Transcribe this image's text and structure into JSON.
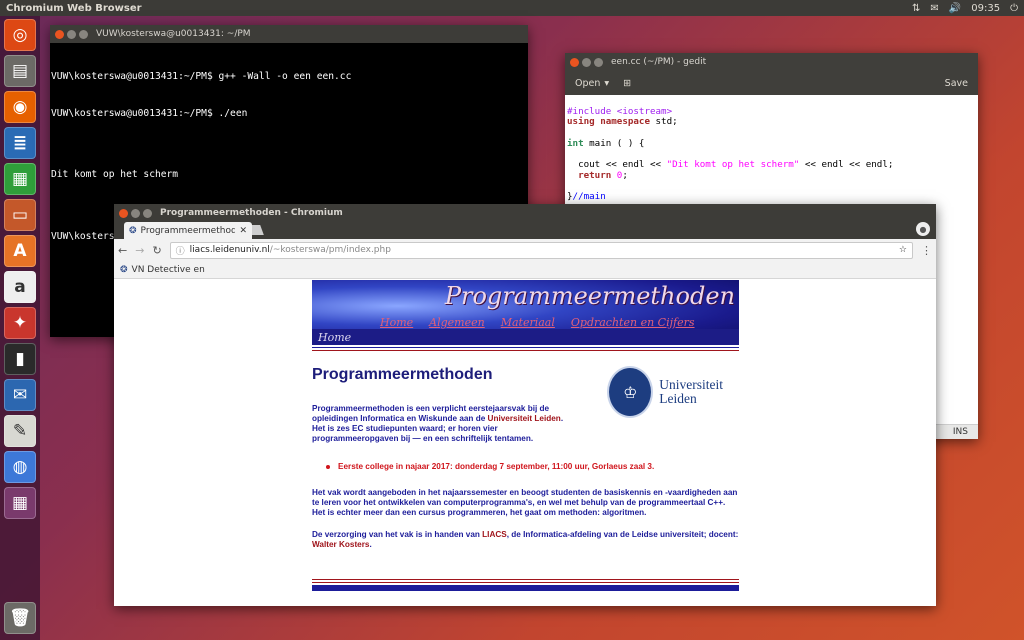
{
  "topbar": {
    "title": "Chromium Web Browser",
    "time": "09:35"
  },
  "launcher": [
    {
      "name": "ubuntu-dash-icon",
      "color": "#dd4814",
      "glyph": "◎"
    },
    {
      "name": "files-icon",
      "color": "#6c6a66",
      "glyph": "▤"
    },
    {
      "name": "firefox-icon",
      "color": "#e66000",
      "glyph": "◉"
    },
    {
      "name": "writer-icon",
      "color": "#2a6bb5",
      "glyph": "≣"
    },
    {
      "name": "calc-icon",
      "color": "#2f9e3a",
      "glyph": "▦"
    },
    {
      "name": "impress-icon",
      "color": "#c4582a",
      "glyph": "▭"
    },
    {
      "name": "software-center-icon",
      "color": "#e67326",
      "glyph": "A"
    },
    {
      "name": "amazon-icon",
      "color": "#efefef",
      "glyph": "a"
    },
    {
      "name": "system-settings-icon",
      "color": "#c9362d",
      "glyph": "✦"
    },
    {
      "name": "terminal-icon",
      "color": "#2a2a2a",
      "glyph": "▮"
    },
    {
      "name": "thunderbird-icon",
      "color": "#2c67b0",
      "glyph": "✉"
    },
    {
      "name": "text-editor-icon",
      "color": "#d8d8d2",
      "glyph": "✎"
    },
    {
      "name": "chromium-icon",
      "color": "#3d78d8",
      "glyph": "◍"
    },
    {
      "name": "workspaces-icon",
      "color": "#7a3a6c",
      "glyph": "▦"
    }
  ],
  "terminal": {
    "title": "VUW\\kosterswa@u0013431: ~/PM",
    "lines": [
      "VUW\\kosterswa@u0013431:~/PM$ g++ -Wall -o een een.cc",
      "VUW\\kosterswa@u0013431:~/PM$ ./een",
      "",
      "Dit komt op het scherm",
      "",
      "VUW\\kosterswa@u0013431:~/PM$ "
    ]
  },
  "gedit": {
    "title": "een.cc (~/PM) - gedit",
    "open_label": "Open",
    "save_label": "Save",
    "status": "INS",
    "code": {
      "include": "#include <iostream>",
      "using_kw": "using namespace",
      "using_rest": " std;",
      "int_kw": "int",
      "main_rest": " main ( ) {",
      "cout_a": "  cout << endl << ",
      "cout_str": "\"Dit komt op het scherm\"",
      "cout_b": " << endl << endl;",
      "return_kw": "  return",
      "return_num": " 0",
      "return_end": ";",
      "close_brace": "}",
      "comment": "//main"
    }
  },
  "chromium": {
    "title": "Programmeermethoden - Chromium",
    "tab_title": "Programmeermethoden",
    "url_host": "liacs.leidenuniv.nl",
    "url_path": "/~kosterswa/pm/index.php",
    "bookmark": "VN Detective en"
  },
  "page": {
    "banner_title": "Programmeermethoden",
    "nav": [
      "Home",
      "Algemeen",
      "Materiaal",
      "Opdrachten en Cijfers"
    ],
    "banner_home": "Home",
    "heading": "Programmeermethoden",
    "logo_line1": "Universiteit",
    "logo_line2": "Leiden",
    "intro_a": "Programmeermethoden is een verplicht eerstejaarsvak bij de opleidingen Informatica en Wiskunde aan de ",
    "intro_link": "Universiteit Leiden",
    "intro_b": ". Het is zes EC studiepunten waard; er horen vier programmeeropgaven bij — en een schriftelijk tentamen.",
    "bullet": "Eerste college in najaar 2017: donderdag 7 september, 11:00 uur, Gorlaeus zaal 3.",
    "para2": "Het vak wordt aangeboden in het najaarssemester en beoogt studenten de basiskennis en -vaardigheden aan te leren voor het ontwikkelen van computerprogramma's, en wel met behulp van de programmeertaal C++. Het is echter meer dan een cursus programmeren, het gaat om methoden: algoritmen.",
    "para3_a": "De verzorging van het vak is in handen van ",
    "para3_liacs": "LIACS",
    "para3_b": ", de Informatica-afdeling van de Leidse universiteit; docent: ",
    "para3_name": "Walter Kosters",
    "para3_end": "."
  },
  "colors": {
    "accent": "#e95420",
    "navy": "#1d1d9a",
    "red": "#a0151c"
  }
}
